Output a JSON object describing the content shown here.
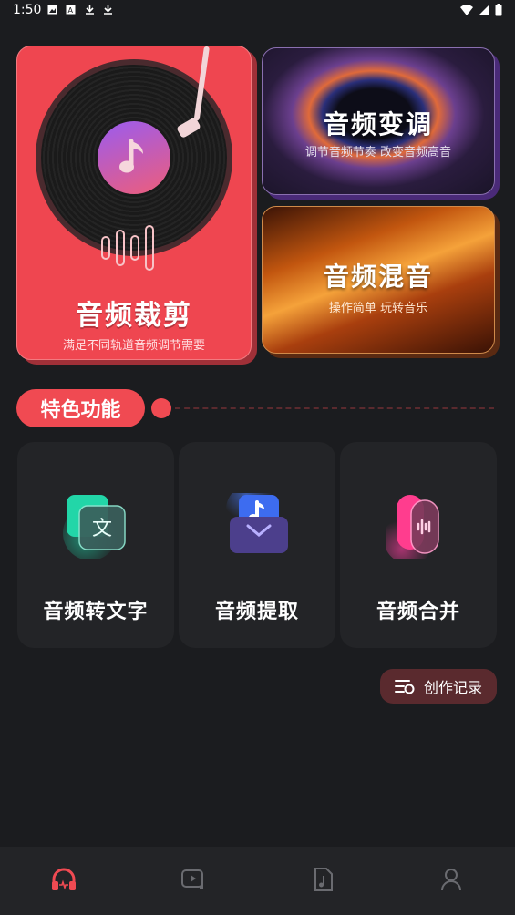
{
  "status_bar": {
    "time": "1:50"
  },
  "cards": {
    "cut": {
      "title": "音频裁剪",
      "subtitle": "满足不同轨道音频调节需要"
    },
    "pitch": {
      "title": "音频变调",
      "subtitle": "调节音频节奏 改变音频高音"
    },
    "mix": {
      "title": "音频混音",
      "subtitle": "操作简单 玩转音乐"
    }
  },
  "features": {
    "title": "特色功能",
    "items": [
      {
        "label": "音频转文字",
        "icon": "translate-icon"
      },
      {
        "label": "音频提取",
        "icon": "extract-icon"
      },
      {
        "label": "音频合并",
        "icon": "merge-icon"
      }
    ]
  },
  "record_button": {
    "label": "创作记录"
  },
  "tabbar": {
    "tabs": [
      {
        "icon": "headphones-icon",
        "active": true
      },
      {
        "icon": "video-icon",
        "active": false
      },
      {
        "icon": "music-file-icon",
        "active": false
      },
      {
        "icon": "profile-icon",
        "active": false
      }
    ]
  },
  "colors": {
    "accent": "#f04a52",
    "background": "#1b1c1f",
    "tile": "#232427"
  }
}
